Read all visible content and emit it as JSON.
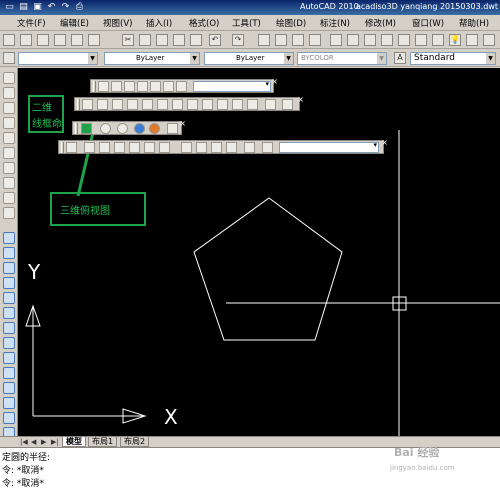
{
  "titlebar": {
    "app_name": "AutoCAD 2010",
    "document": "acadiso3D  yanqiang 20150303.dwt",
    "quick_access": [
      "new-icon",
      "open-icon",
      "save-icon",
      "undo-icon",
      "redo-icon",
      "print-icon"
    ]
  },
  "menu": {
    "items": [
      "文件(F)",
      "编辑(E)",
      "视图(V)",
      "插入(I)",
      "格式(O)",
      "工具(T)",
      "绘图(D)",
      "标注(N)",
      "修改(M)",
      "窗口(W)",
      "帮助(H)"
    ]
  },
  "properties_toolbar": {
    "layer_value": "",
    "color_value": "ByLayer",
    "linetype_value": "ByLayer",
    "lineweight_value": "BYCOLOR",
    "text_style_value": "Standard"
  },
  "tabs": {
    "items": [
      "模型",
      "布局1",
      "布局2"
    ],
    "active": "模型"
  },
  "command_window": {
    "lines": [
      "定圆的半径:",
      "令: *取消*",
      "令: *取消*"
    ]
  },
  "annotations": {
    "wireframe_note": "二维\n线框命",
    "top_view_note": "三维俯视图"
  },
  "canvas": {
    "ucs_x_label": "X",
    "ucs_y_label": "Y",
    "background": "#000000",
    "stroke_color": "#ffffff"
  },
  "watermark": {
    "text": "Bai 经验",
    "subtext": "jingyan.baidu.com"
  },
  "colors": {
    "annotation_green": "#1fa34a",
    "titlebar_blue": "#0a246a"
  }
}
